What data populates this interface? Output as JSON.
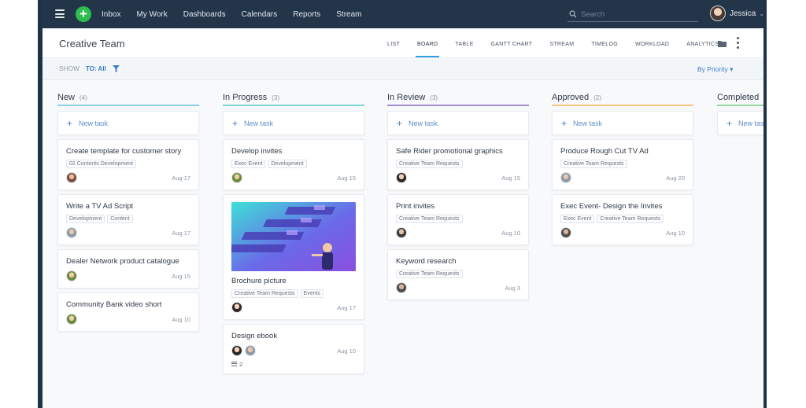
{
  "nav": {
    "items": [
      "Inbox",
      "My Work",
      "Dashboards",
      "Calendars",
      "Reports",
      "Stream"
    ],
    "search_placeholder": "Search",
    "user_name": "Jessica"
  },
  "header": {
    "title": "Creative Team",
    "views": [
      "LIST",
      "BOARD",
      "TABLE",
      "GANTT CHART",
      "STREAM",
      "TIMELOG",
      "WORKLOAD",
      "ANALYTICS"
    ],
    "active_view": "BOARD"
  },
  "filter": {
    "show_label": "SHOW",
    "to_all": "TO: All",
    "sort": "By Priority"
  },
  "new_task_label": "New task",
  "columns": [
    {
      "title": "New",
      "count": "(4)",
      "color": "#8ad3e3",
      "cards": [
        {
          "title": "Create template for customer story",
          "tags": [
            "02 Contents Development"
          ],
          "due": "Aug 17"
        },
        {
          "title": "Write a TV Ad Script",
          "tags": [
            "Development",
            "Content"
          ],
          "due": "Aug 17"
        },
        {
          "title": "Dealer Network product catalogue",
          "tags": [],
          "due": "Aug 15"
        },
        {
          "title": "Community Bank video short",
          "tags": [],
          "due": "Aug 10"
        }
      ]
    },
    {
      "title": "In Progress",
      "count": "(3)",
      "color": "#7fd6d3",
      "cards": [
        {
          "title": "Develop invites",
          "tags": [
            "Exec Event",
            "Development"
          ],
          "due": "Aug 15"
        },
        {
          "title": "Brochure picture",
          "tags": [
            "Creative Team Requests",
            "Events"
          ],
          "due": "Aug 17"
        },
        {
          "title": "Design ebook",
          "tags": [],
          "due": "Aug 10",
          "subtasks": "2"
        }
      ]
    },
    {
      "title": "In Review",
      "count": "(3)",
      "color": "#a78bd0",
      "cards": [
        {
          "title": "Safe Rider promotional graphics",
          "tags": [
            "Creative Team Requests"
          ],
          "due": "Aug 15"
        },
        {
          "title": "Print invites",
          "tags": [
            "Creative Team Requests"
          ],
          "due": "Aug 10"
        },
        {
          "title": "Keyword research",
          "tags": [
            "Creative Team Requests"
          ],
          "due": "Aug 3"
        }
      ]
    },
    {
      "title": "Approved",
      "count": "(2)",
      "color": "#f5c77e",
      "cards": [
        {
          "title": "Produce Rough Cut TV Ad",
          "tags": [
            "Creative Team Requests"
          ],
          "due": "Aug 20"
        },
        {
          "title": "Exec Event- Design the Invites",
          "tags": [
            "Exec Event",
            "Creative Team Requests"
          ],
          "due": "Aug 10"
        }
      ]
    },
    {
      "title": "Completed",
      "count": "",
      "color": "#9ad9a3",
      "cards": []
    }
  ],
  "colors": {
    "topbar": "#233549",
    "accent": "#2f9de0",
    "link": "#3f7dc0",
    "add_button": "#2ebc4f"
  }
}
